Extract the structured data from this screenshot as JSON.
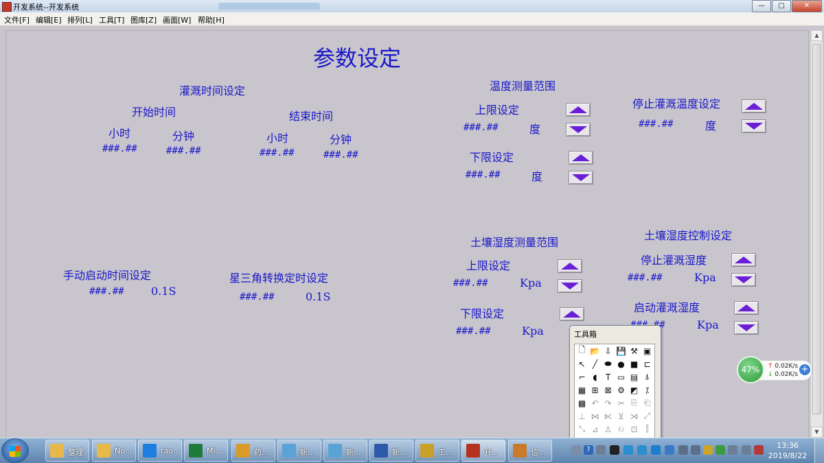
{
  "window": {
    "title": "开发系统--开发系统",
    "buttons": {
      "minimize": "—",
      "maximize": "□",
      "close": "✕"
    }
  },
  "menu": [
    "文件[F]",
    "编辑[E]",
    "排列[L]",
    "工具[T]",
    "图库[Z]",
    "画面[W]",
    "帮助[H]"
  ],
  "main": {
    "title": "参数设定",
    "irrigation_time": {
      "heading": "灌溉时间设定",
      "start": {
        "label": "开始时间",
        "hour_label": "小时",
        "minute_label": "分钟",
        "hour_value": "###.##",
        "minute_value": "###.##"
      },
      "end": {
        "label": "结束时间",
        "hour_label": "小时",
        "minute_label": "分钟",
        "hour_value": "###.##",
        "minute_value": "###.##"
      }
    },
    "temperature_range": {
      "heading": "温度测量范围",
      "upper": {
        "label": "上限设定",
        "value": "###.##",
        "unit": "度"
      },
      "lower": {
        "label": "下限设定",
        "value": "###.##",
        "unit": "度"
      }
    },
    "stop_irrigation_temp": {
      "label": "停止灌溉温度设定",
      "value": "###.##",
      "unit": "度"
    },
    "manual_start": {
      "label": "手动启动时间设定",
      "value": "###.##",
      "unit": "0.1S"
    },
    "star_delta": {
      "label": "星三角转换定时设定",
      "value": "###.##",
      "unit": "0.1S"
    },
    "soil_humidity_range": {
      "heading": "土壤湿度测量范围",
      "upper": {
        "label": "上限设定",
        "value": "###.##",
        "unit": "Kpa"
      },
      "lower": {
        "label": "下限设定",
        "value": "###.##",
        "unit": "Kpa"
      }
    },
    "soil_humidity_control": {
      "heading": "土壤湿度控制设定",
      "stop": {
        "label": "停止灌溉湿度",
        "value": "###.##",
        "unit": "Kpa"
      },
      "start": {
        "label": "启动灌溉湿度",
        "value": "###.##",
        "unit": "Kpa"
      }
    }
  },
  "toolbox": {
    "title": "工具箱",
    "tools": [
      {
        "glyph": "🗋",
        "enabled": true
      },
      {
        "glyph": "📂",
        "enabled": true
      },
      {
        "glyph": "⇩",
        "enabled": true
      },
      {
        "glyph": "💾",
        "enabled": true
      },
      {
        "glyph": "⚒",
        "enabled": true
      },
      {
        "glyph": "▣",
        "enabled": true
      },
      {
        "glyph": "↖",
        "enabled": true
      },
      {
        "glyph": "╱",
        "enabled": true
      },
      {
        "glyph": "⬬",
        "enabled": true
      },
      {
        "glyph": "●",
        "enabled": true
      },
      {
        "glyph": "■",
        "enabled": true
      },
      {
        "glyph": "⊏",
        "enabled": true
      },
      {
        "glyph": "⌐",
        "enabled": true
      },
      {
        "glyph": "◖",
        "enabled": true
      },
      {
        "glyph": "T",
        "enabled": true
      },
      {
        "glyph": "▭",
        "enabled": true
      },
      {
        "glyph": "▤",
        "enabled": true
      },
      {
        "glyph": "⍋",
        "enabled": true
      },
      {
        "glyph": "▦",
        "enabled": true
      },
      {
        "glyph": "⊞",
        "enabled": true
      },
      {
        "glyph": "⊠",
        "enabled": true
      },
      {
        "glyph": "⚙",
        "enabled": true
      },
      {
        "glyph": "◩",
        "enabled": true
      },
      {
        "glyph": "⁒",
        "enabled": true
      },
      {
        "glyph": "▩",
        "enabled": true
      },
      {
        "glyph": "↶",
        "enabled": false
      },
      {
        "glyph": "↷",
        "enabled": false
      },
      {
        "glyph": "✂",
        "enabled": false
      },
      {
        "glyph": "⎘",
        "enabled": false
      },
      {
        "glyph": "⎗",
        "enabled": false
      },
      {
        "glyph": "⊥",
        "enabled": false
      },
      {
        "glyph": "⋈",
        "enabled": false
      },
      {
        "glyph": "⋉",
        "enabled": false
      },
      {
        "glyph": "⊻",
        "enabled": false
      },
      {
        "glyph": "⋊",
        "enabled": false
      },
      {
        "glyph": "⤢",
        "enabled": false
      },
      {
        "glyph": "⤡",
        "enabled": false
      },
      {
        "glyph": "⊿",
        "enabled": false
      },
      {
        "glyph": "♙",
        "enabled": false
      },
      {
        "glyph": "⎌",
        "enabled": false
      },
      {
        "glyph": "⊡",
        "enabled": false
      },
      {
        "glyph": "⫿",
        "enabled": false
      }
    ]
  },
  "network_widget": {
    "percent": "47%",
    "upload": "0.02K/s",
    "download": "0.02K/s",
    "plus": "+"
  },
  "taskbar": {
    "items": [
      {
        "label": "整理",
        "color": "#e8b84a"
      },
      {
        "label": "No...",
        "color": "#e8b84a"
      },
      {
        "label": "tao...",
        "color": "#1c7fe0"
      },
      {
        "label": "Mi...",
        "color": "#1f7a3c"
      },
      {
        "label": "药...",
        "color": "#d99a2a"
      },
      {
        "label": "新...",
        "color": "#5aa3d6"
      },
      {
        "label": "新...",
        "color": "#5aa3d6"
      },
      {
        "label": "新...",
        "color": "#2d5aa8"
      },
      {
        "label": "工...",
        "color": "#c9a02a"
      },
      {
        "label": "开...",
        "color": "#b5321e"
      },
      {
        "label": "信...",
        "color": "#c97a2a"
      }
    ],
    "clock": {
      "time": "13:36",
      "date": "2019/8/22"
    }
  }
}
